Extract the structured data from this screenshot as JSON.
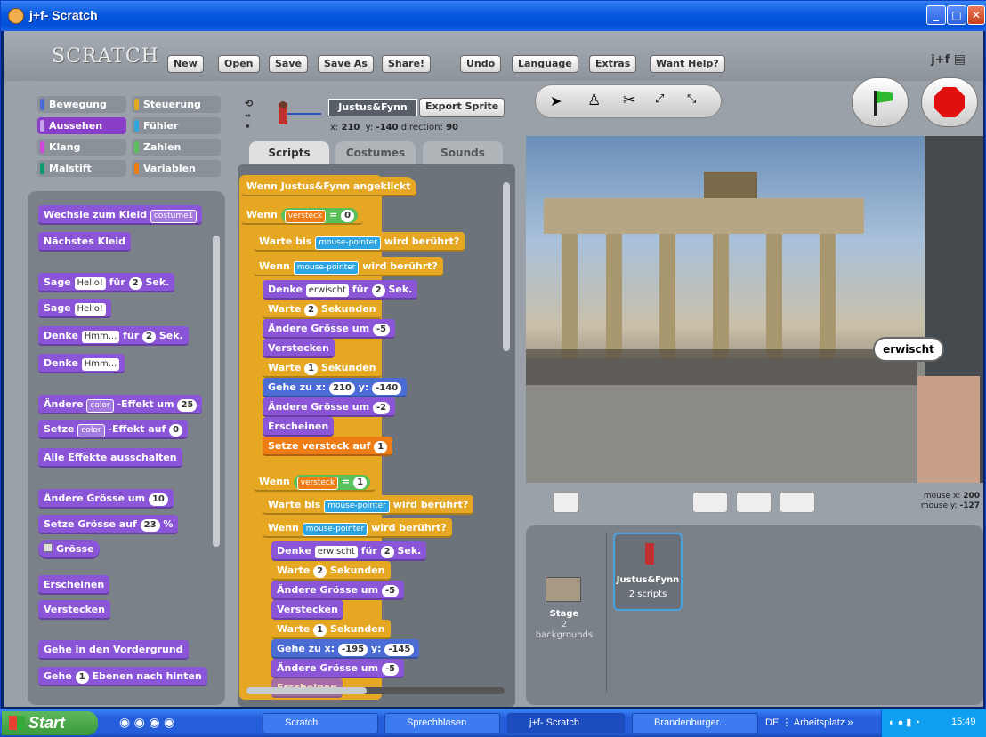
{
  "window": {
    "title": "j+f- Scratch"
  },
  "app": {
    "logo": "SCRATCH",
    "menu": [
      "New",
      "Open",
      "Save",
      "Save As",
      "Share!",
      "Undo",
      "Language",
      "Extras",
      "Want Help?"
    ],
    "user": "j+f"
  },
  "categories": [
    {
      "label": "Bewegung",
      "color": "#4a6cd4"
    },
    {
      "label": "Steuerung",
      "color": "#e6a822"
    },
    {
      "label": "Aussehen",
      "color": "#8a55d7"
    },
    {
      "label": "Fühler",
      "color": "#2ca5e2"
    },
    {
      "label": "Klang",
      "color": "#cf4ad9"
    },
    {
      "label": "Zahlen",
      "color": "#59c059"
    },
    {
      "label": "Malstift",
      "color": "#0e9a6c"
    },
    {
      "label": "Variablen",
      "color": "#ee7d16"
    }
  ],
  "palette": {
    "b1": "Wechsle zum Kleid",
    "b1_drop": "costume1",
    "b2": "Nächstes Kleid",
    "b3a": "Sage",
    "b3_slot": "Hello!",
    "b3b": "für",
    "b3_num": "2",
    "b3c": "Sek.",
    "b4a": "Sage",
    "b4_slot": "Hello!",
    "b5a": "Denke",
    "b5_slot": "Hmm...",
    "b5b": "für",
    "b5_num": "2",
    "b5c": "Sek.",
    "b6a": "Denke",
    "b6_slot": "Hmm...",
    "b7a": "Ändere",
    "b7_drop": "color",
    "b7b": "-Effekt um",
    "b7_num": "25",
    "b8a": "Setze",
    "b8_drop": "color",
    "b8b": "-Effekt auf",
    "b8_num": "0",
    "b9": "Alle Effekte ausschalten",
    "b10a": "Ändere Grösse um",
    "b10_num": "10",
    "b11a": "Setze Grösse auf",
    "b11_num": "23",
    "b11b": "%",
    "b12": "Grösse",
    "b13": "Erscheinen",
    "b14": "Verstecken",
    "b15": "Gehe in den Vordergrund",
    "b16a": "Gehe",
    "b16_num": "1",
    "b16b": "Ebenen nach hinten"
  },
  "sprite": {
    "name": "Justus&Fynn",
    "export": "Export Sprite",
    "x_label": "x:",
    "x": "210",
    "y_label": "y:",
    "y": "-140",
    "dir_label": "direction:",
    "direction": "90"
  },
  "tabs": [
    "Scripts",
    "Costumes",
    "Sounds"
  ],
  "script": {
    "hat": "Wenn Justus&Fynn angeklickt",
    "if1": "Wenn",
    "var": "versteck",
    "eq": "=",
    "v0": "0",
    "wait_until": "Warte bis",
    "mp": "mouse-pointer",
    "touching": "wird berührt?",
    "if2": "Wenn",
    "think": "Denke",
    "erwischt": "erwischt",
    "fuer": "für",
    "two": "2",
    "sek": "Sek.",
    "wait": "Warte",
    "sekunden": "Sekunden",
    "change_size": "Ändere Grösse um",
    "m5": "-5",
    "hide": "Verstecken",
    "one": "1",
    "goto": "Gehe zu x:",
    "gx1": "210",
    "gy_label": "y:",
    "gy1": "-140",
    "m2": "-2",
    "show": "Erscheinen",
    "setvar": "Setze versteck auf",
    "set1": "1",
    "if3": "Wenn",
    "v1": "1",
    "gx2": "-195",
    "gy2": "-145",
    "partial": "Erscheinen"
  },
  "stage": {
    "bubble": "erwischt",
    "mouse_x_label": "mouse x:",
    "mouse_x": "200",
    "mouse_y_label": "mouse y:",
    "mouse_y": "-127"
  },
  "sprites_pane": {
    "stage_label": "Stage",
    "stage_sub": "2 backgrounds",
    "sprite_label": "Justus&Fynn",
    "sprite_sub": "2 scripts"
  },
  "taskbar": {
    "start": "Start",
    "items": [
      "Scratch",
      "Sprechblasen",
      "j+f- Scratch",
      "Brandenburger..."
    ],
    "lang": "DE",
    "workspace": "Arbeitsplatz",
    "time": "15:49"
  }
}
